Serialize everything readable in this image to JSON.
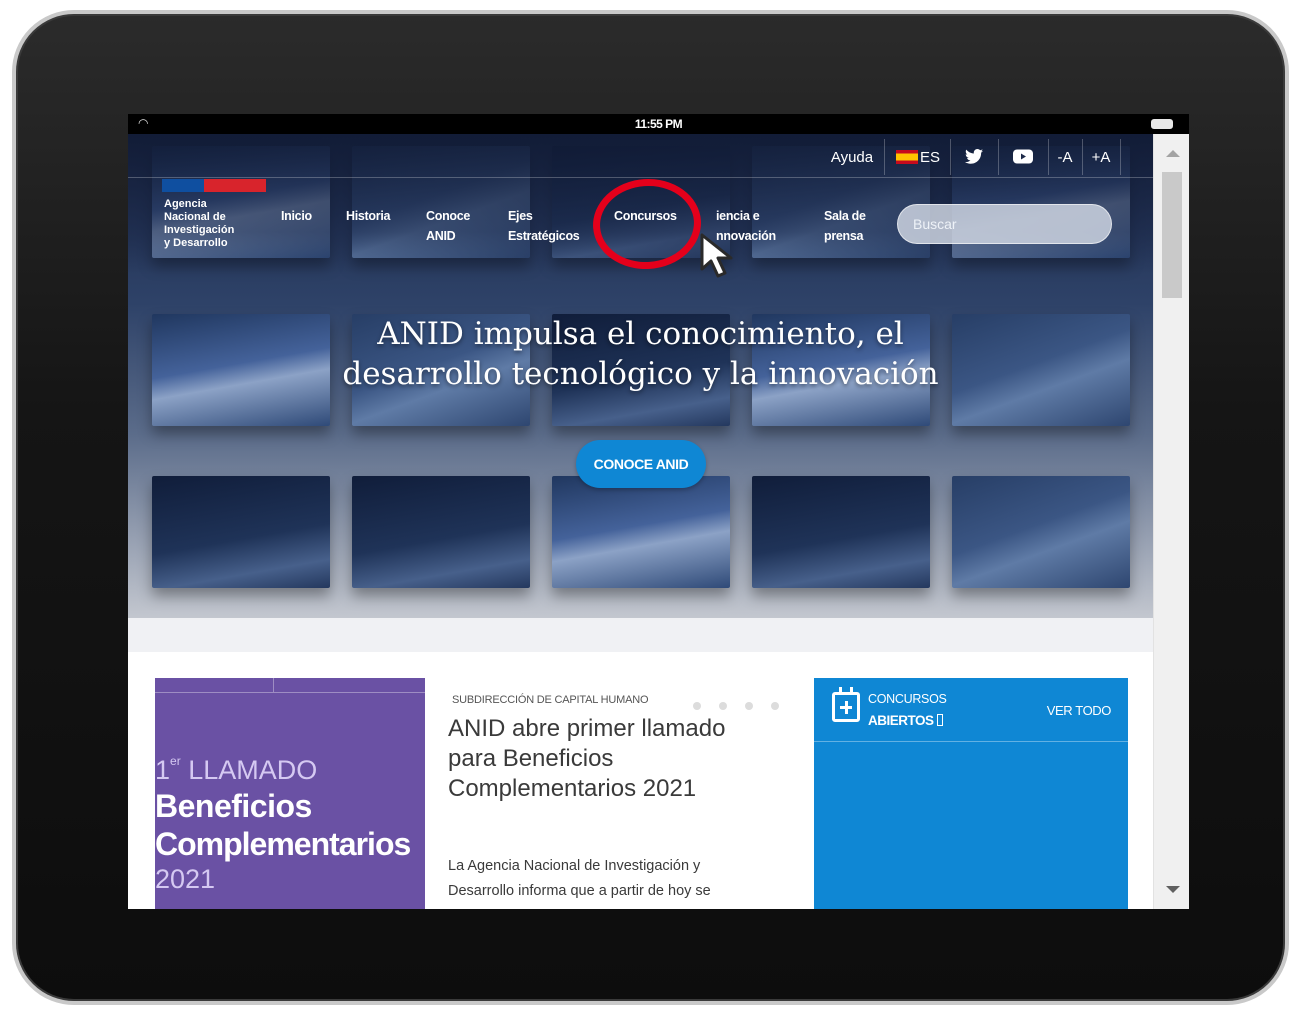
{
  "device": {
    "time": "11:55 PM"
  },
  "topbar": {
    "help": "Ayuda",
    "language": "ES",
    "text_decrease": "-A",
    "text_increase": "+A"
  },
  "logo": {
    "line1": "Agencia",
    "line2": "Nacional de",
    "line3": "Investigación",
    "line4": "y Desarrollo"
  },
  "nav": {
    "items": [
      {
        "line1": "Inicio",
        "line2": ""
      },
      {
        "line1": "Historia",
        "line2": ""
      },
      {
        "line1": "Conoce",
        "line2": "ANID"
      },
      {
        "line1": "Ejes",
        "line2": "Estratégicos"
      },
      {
        "line1": "Concursos",
        "line2": ""
      },
      {
        "line1": "iencia e",
        "line2": "nnovación"
      },
      {
        "line1": "Sala de",
        "line2": "prensa"
      }
    ]
  },
  "search": {
    "placeholder": "Buscar"
  },
  "hero": {
    "title_line1": "ANID impulsa el conocimiento, el",
    "title_line2": "desarrollo tecnológico y la innovación",
    "button": "CONOCE ANID"
  },
  "news": {
    "image_text": {
      "ordinal": "1",
      "ordinal_suffix": "er",
      "call": "LLAMADO",
      "word1": "Beneficios",
      "word2": "Complementarios",
      "year": "2021"
    },
    "category": "SUBDIRECCIÓN DE CAPITAL HUMANO",
    "title": "ANID abre primer llamado para Beneficios Complementarios 2021",
    "excerpt_line1": "La Agencia Nacional de Investigación y",
    "excerpt_line2": "Desarrollo informa que a partir de hoy se"
  },
  "contests": {
    "label_line1": "CONCURSOS",
    "label_line2": "ABIERTOS",
    "view_all": "VER TODO"
  },
  "colors": {
    "accent_blue": "#0f87d4",
    "purple": "#6a51a4",
    "highlight_red": "#e4001b",
    "logo_blue": "#0f4fa0",
    "logo_red": "#d8242c"
  }
}
